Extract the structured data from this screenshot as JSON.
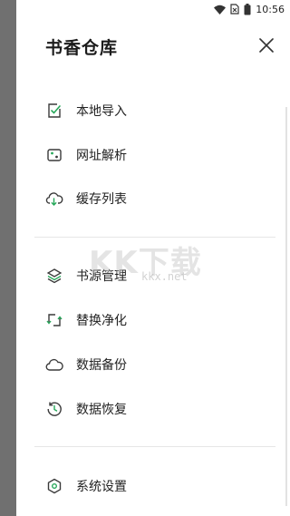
{
  "status_bar": {
    "time": "10:56"
  },
  "drawer": {
    "title": "书香仓库",
    "groups": [
      [
        {
          "label": "本地导入",
          "icon": "import-check-icon"
        },
        {
          "label": "网址解析",
          "icon": "scan-frame-icon"
        },
        {
          "label": "缓存列表",
          "icon": "cloud-download-icon"
        }
      ],
      [
        {
          "label": "书源管理",
          "icon": "layers-icon"
        },
        {
          "label": "替换净化",
          "icon": "replace-arrows-icon"
        },
        {
          "label": "数据备份",
          "icon": "cloud-icon"
        },
        {
          "label": "数据恢复",
          "icon": "restore-clock-icon"
        }
      ],
      [
        {
          "label": "系统设置",
          "icon": "settings-icon"
        }
      ]
    ]
  },
  "watermark": {
    "main": "KK下载",
    "sub": "kkx.net"
  },
  "colors": {
    "accent": "#27a85a",
    "icon_stroke": "#3a3a3a"
  }
}
